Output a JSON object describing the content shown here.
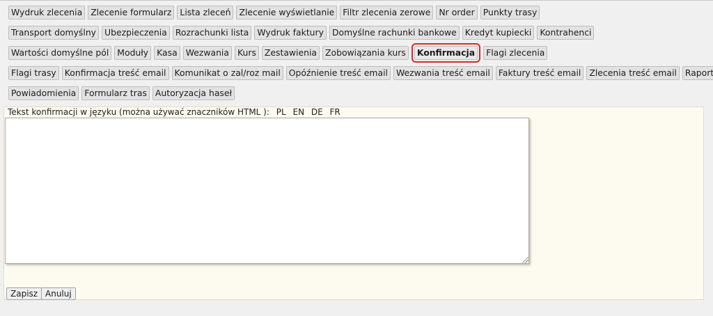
{
  "tab_rows": [
    [
      "Wydruk zlecenia",
      "Zlecenie formularz",
      "Lista zleceń",
      "Zlecenie wyświetlanie",
      "Filtr zlecenia zerowe",
      "Nr order",
      "Punkty trasy"
    ],
    [
      "Transport domyślny",
      "Ubezpieczenia",
      "Rozrachunki lista",
      "Wydruk faktury",
      "Domyślne rachunki bankowe",
      "Kredyt kupiecki",
      "Kontrahenci"
    ],
    [
      "Wartości domyślne pól",
      "Moduły",
      "Kasa",
      "Wezwania",
      "Kurs",
      "Zestawienia",
      "Zobowiązania kurs",
      "Konfirmacja",
      "Flagi zlecenia"
    ],
    [
      "Flagi trasy",
      "Konfirmacja treść email",
      "Komunikat o zal/roz mail",
      "Opóźnienie treść email",
      "Wezwania treść email",
      "Faktury treść email",
      "Zlecenia treść email",
      "Raport dla"
    ],
    [
      "Powiadomienia",
      "Formularz tras",
      "Autoryzacja haseł"
    ]
  ],
  "active_tab": "Konfirmacja",
  "form": {
    "label": "Tekst konfirmacji w języku (można używać znaczników HTML ):",
    "languages": [
      "PL",
      "EN",
      "DE",
      "FR"
    ],
    "textarea_value": ""
  },
  "actions": {
    "save_label": "Zapisz",
    "cancel_label": "Anuluj"
  },
  "colors": {
    "active_outline": "#d9262b",
    "panel_background": "#fdfaf0",
    "page_background": "#f0f0f0"
  }
}
